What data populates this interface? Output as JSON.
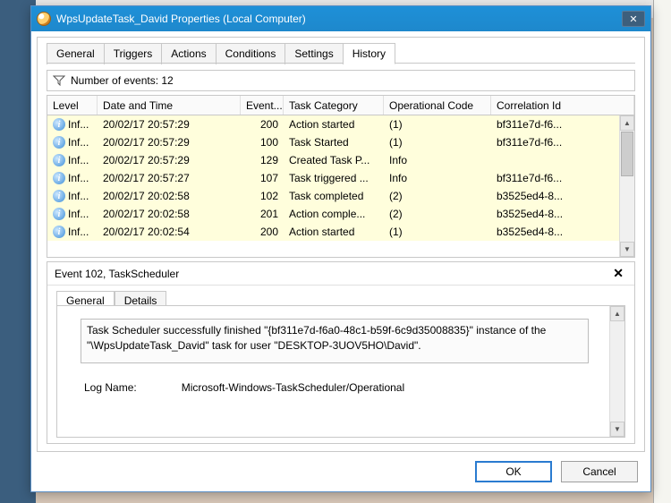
{
  "window": {
    "title": "WpsUpdateTask_David Properties (Local Computer)"
  },
  "tabs": {
    "general": "General",
    "triggers": "Triggers",
    "actions": "Actions",
    "conditions": "Conditions",
    "settings": "Settings",
    "history": "History"
  },
  "history": {
    "count_label": "Number of events: 12",
    "columns": {
      "level": "Level",
      "date": "Date and Time",
      "event": "Event...",
      "task": "Task Category",
      "op": "Operational Code",
      "corr": "Correlation Id"
    },
    "rows": [
      {
        "level": "Inf...",
        "date": "20/02/17 20:57:29",
        "event": "200",
        "task": "Action started",
        "op": "(1)",
        "corr": "bf311e7d-f6..."
      },
      {
        "level": "Inf...",
        "date": "20/02/17 20:57:29",
        "event": "100",
        "task": "Task Started",
        "op": "(1)",
        "corr": "bf311e7d-f6..."
      },
      {
        "level": "Inf...",
        "date": "20/02/17 20:57:29",
        "event": "129",
        "task": "Created Task P...",
        "op": "Info",
        "corr": ""
      },
      {
        "level": "Inf...",
        "date": "20/02/17 20:57:27",
        "event": "107",
        "task": "Task triggered ...",
        "op": "Info",
        "corr": "bf311e7d-f6..."
      },
      {
        "level": "Inf...",
        "date": "20/02/17 20:02:58",
        "event": "102",
        "task": "Task completed",
        "op": "(2)",
        "corr": "b3525ed4-8..."
      },
      {
        "level": "Inf...",
        "date": "20/02/17 20:02:58",
        "event": "201",
        "task": "Action comple...",
        "op": "(2)",
        "corr": "b3525ed4-8..."
      },
      {
        "level": "Inf...",
        "date": "20/02/17 20:02:54",
        "event": "200",
        "task": "Action started",
        "op": "(1)",
        "corr": "b3525ed4-8..."
      }
    ]
  },
  "event_detail": {
    "header": "Event 102, TaskScheduler",
    "tabs": {
      "general": "General",
      "details": "Details"
    },
    "message": "Task Scheduler successfully finished \"{bf311e7d-f6a0-48c1-b59f-6c9d35008835}\" instance of the \"\\WpsUpdateTask_David\" task for user \"DESKTOP-3UOV5HO\\David\".",
    "log_name_label": "Log Name:",
    "log_name_value": "Microsoft-Windows-TaskScheduler/Operational"
  },
  "buttons": {
    "ok": "OK",
    "cancel": "Cancel"
  }
}
